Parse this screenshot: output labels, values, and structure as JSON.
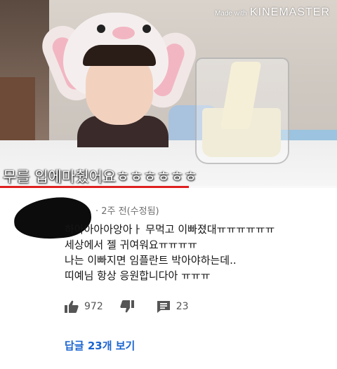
{
  "video": {
    "watermark_small": "Made with",
    "watermark_big": "KINEMASTER",
    "subtitle": "무를 입에마췄어요ㅎㅎㅎㅎㅎㅎ",
    "progress_fraction": 0.56,
    "progress_color": "#e02020"
  },
  "comment": {
    "meta": "· 2주 전(수정됨)",
    "lines": [
      "하아아아아앙아ㅏ 무먹고 이빠졌대ㅠㅠㅠㅠㅠㅠ",
      "세상에서 젤 귀여워요ㅠㅠㅠㅠ",
      "나는 이빠지면 임플란트 박아야하는데..",
      "띠예님 항상 응원합니다아 ㅠㅠㅠ"
    ],
    "like_count": "972",
    "reply_count": "23",
    "replies_link": "답글 23개 보기",
    "icons": [
      "thumbs-up-icon",
      "thumbs-down-icon",
      "comment-icon"
    ],
    "link_color": "#1a65d0"
  }
}
